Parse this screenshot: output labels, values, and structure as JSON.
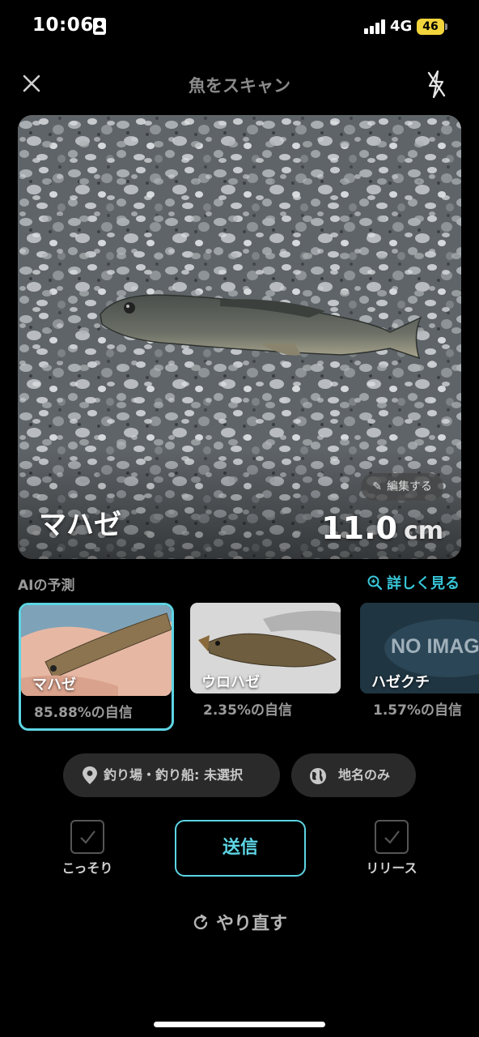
{
  "status_bar": {
    "time": "10:06",
    "network": "4G",
    "battery": "46"
  },
  "header": {
    "title": "魚をスキャン",
    "close_icon": "close-icon",
    "flash_icon": "flash-off-icon"
  },
  "photo": {
    "edit_label": "編集する",
    "species": "マハゼ",
    "length_value": "11.0",
    "length_unit": "cm"
  },
  "ai": {
    "label": "AIの予測",
    "detail_link": "詳しく見る",
    "candidates": [
      {
        "name": "マハゼ",
        "confidence": "85.88%の自信",
        "selected": true
      },
      {
        "name": "ウロハゼ",
        "confidence": "2.35%の自信",
        "selected": false
      },
      {
        "name": "ハゼクチ",
        "confidence": "1.57%の自信",
        "selected": false,
        "placeholder_text": "NO IMAGE"
      }
    ]
  },
  "chips": {
    "spot": "釣り場・釣り船: 未選択",
    "place": "地名のみ"
  },
  "actions": {
    "secret_label": "こっそり",
    "send_label": "送信",
    "release_label": "リリース"
  },
  "retry_label": "やり直す",
  "colors": {
    "accent": "#5dd5e4",
    "background": "#000000",
    "chip": "#2a2a2a"
  }
}
